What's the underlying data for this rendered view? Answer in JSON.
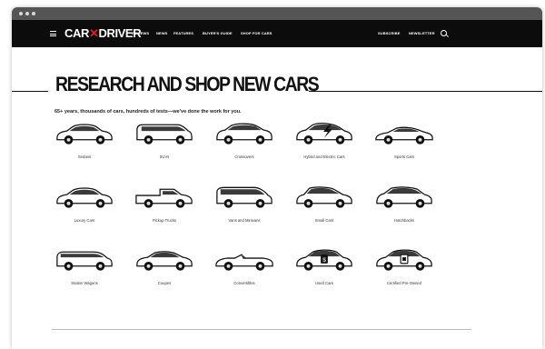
{
  "browser": {
    "window_controls": [
      "close-dot",
      "minimize-dot",
      "maximize-dot"
    ]
  },
  "nav": {
    "logo_left": "CAR",
    "logo_mid": "✕",
    "logo_right": "DRIVER",
    "links": [
      "REVIEWS",
      "NEWS",
      "FEATURES",
      "BUYER'S GUIDE",
      "SHOP FOR CARS"
    ],
    "right_links": [
      "SUBSCRIBE",
      "NEWSLETTER"
    ]
  },
  "page": {
    "title": "RESEARCH AND SHOP NEW CARS",
    "subtitle": "65+ years, thousands of cars, hundreds of tests—we've done the work for you."
  },
  "categories": [
    {
      "label": "Sedans",
      "icon": "sedan-icon"
    },
    {
      "label": "SUVs",
      "icon": "suv-icon"
    },
    {
      "label": "Crossovers",
      "icon": "crossover-icon"
    },
    {
      "label": "Hybrid and Electric Cars",
      "icon": "electric-car-icon"
    },
    {
      "label": "Sports Cars",
      "icon": "sports-car-icon"
    },
    {
      "label": "Luxury Cars",
      "icon": "luxury-car-icon"
    },
    {
      "label": "Pickup Trucks",
      "icon": "pickup-truck-icon"
    },
    {
      "label": "Vans and Minivans",
      "icon": "minivan-icon"
    },
    {
      "label": "Small Cars",
      "icon": "small-car-icon"
    },
    {
      "label": "Hatchbacks",
      "icon": "hatchback-icon"
    },
    {
      "label": "Station Wagons",
      "icon": "wagon-icon"
    },
    {
      "label": "Coupes",
      "icon": "coupe-icon"
    },
    {
      "label": "Convertibles",
      "icon": "convertible-icon"
    },
    {
      "label": "Used Cars",
      "icon": "used-car-icon"
    },
    {
      "label": "Certified Pre-Owned",
      "icon": "certified-car-icon"
    }
  ],
  "colors": {
    "nav_bg": "#0c0c0c",
    "brand_red": "#e11b22",
    "text": "#111111"
  }
}
